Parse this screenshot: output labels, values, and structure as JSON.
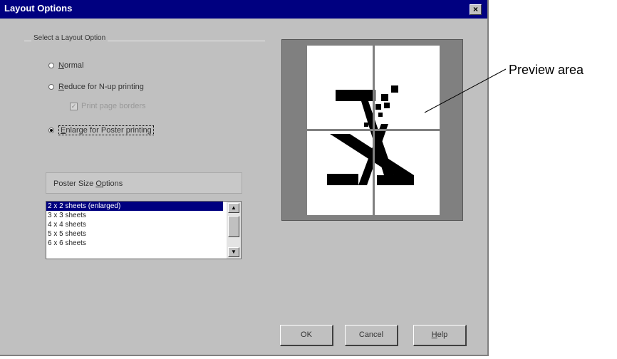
{
  "window": {
    "title": "Layout Options",
    "close_label": "×"
  },
  "layout_group": {
    "label": "Select a Layout Option",
    "options": [
      {
        "underline": "N",
        "rest": "ormal",
        "selected": false
      },
      {
        "underline": "R",
        "rest": "educe for N-up printing",
        "selected": false
      },
      {
        "underline": "E",
        "rest": "nlarge for Poster printing",
        "selected": true
      }
    ],
    "checkbox": {
      "label": "Print page borders",
      "checked": true,
      "enabled": false
    }
  },
  "poster_size": {
    "label_prefix": "Poster Size ",
    "label_underline": "O",
    "label_rest": "ptions",
    "items": [
      "2 x 2 sheets (enlarged)",
      "3 x 3 sheets",
      "4 x 4 sheets",
      "5 x 5 sheets",
      "6 x 6 sheets"
    ],
    "selected_index": 0
  },
  "buttons": {
    "ok": "OK",
    "cancel": "Cancel",
    "help_underline": "H",
    "help_rest": "elp"
  },
  "callout": {
    "label": "Preview area"
  },
  "colors": {
    "titlebar": "#000080",
    "dialog_bg": "#c0c0c0",
    "selection": "#000080"
  }
}
